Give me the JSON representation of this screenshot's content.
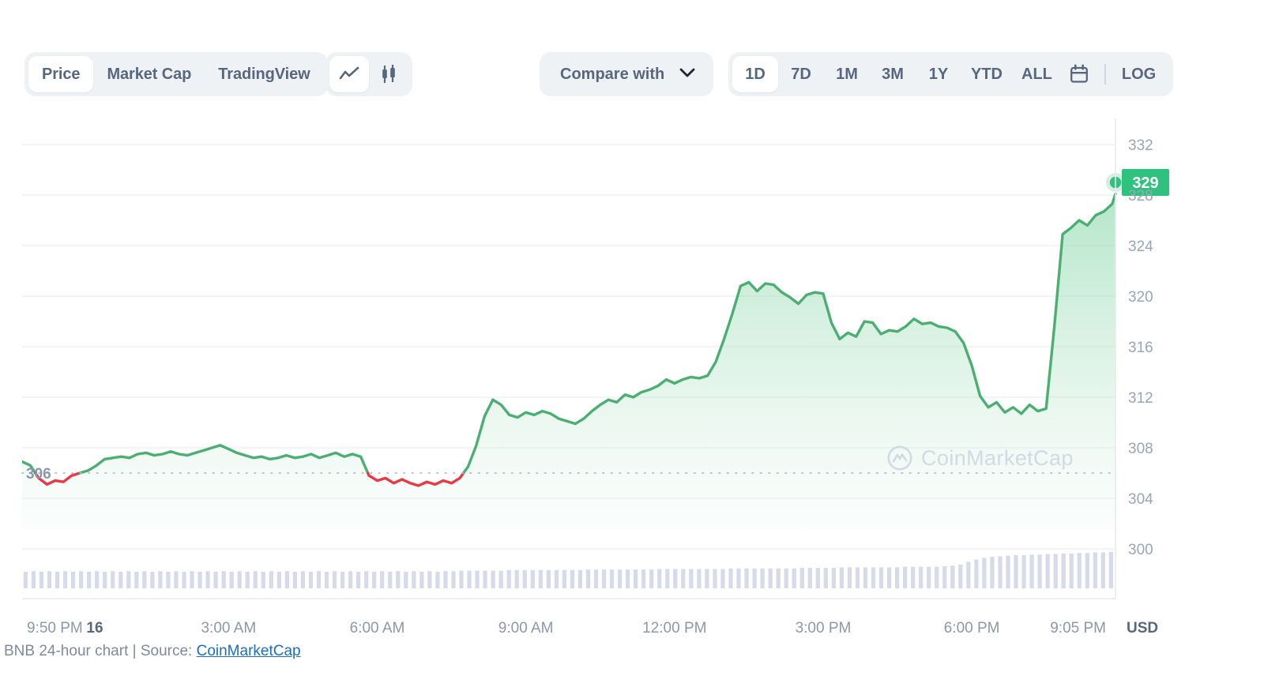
{
  "toolbar": {
    "view_tabs": [
      {
        "label": "Price",
        "active": true
      },
      {
        "label": "Market Cap",
        "active": false
      },
      {
        "label": "TradingView",
        "active": false
      }
    ],
    "chart_type_icons": [
      {
        "name": "line-chart-icon",
        "active": true
      },
      {
        "name": "candlestick-chart-icon",
        "active": false
      }
    ],
    "compare_label": "Compare with",
    "compare_chevron": "chevron-down-icon",
    "ranges": [
      {
        "label": "1D",
        "active": true
      },
      {
        "label": "7D",
        "active": false
      },
      {
        "label": "1M",
        "active": false
      },
      {
        "label": "3M",
        "active": false
      },
      {
        "label": "1Y",
        "active": false
      },
      {
        "label": "YTD",
        "active": false
      },
      {
        "label": "ALL",
        "active": false
      }
    ],
    "calendar_icon": "calendar-icon",
    "log_label": "LOG"
  },
  "watermark": "CoinMarketCap",
  "currency_label": "USD",
  "price_badge": "329",
  "baseline_label": "306",
  "footer": {
    "prefix": "BNB 24-hour chart | Source: ",
    "link": "CoinMarketCap"
  },
  "chart_data": {
    "type": "area",
    "title": "BNB 24-hour chart",
    "xlabel": "",
    "ylabel": "USD",
    "ylim": [
      298,
      333.5
    ],
    "yticks": [
      332,
      328,
      324,
      320,
      316,
      312,
      308,
      304,
      300
    ],
    "grid": true,
    "legend": null,
    "baseline_value": 306,
    "current_value": 329,
    "line_color_up": "#4caf72",
    "line_color_down": "#ea3943",
    "area_color": "#9fdcb9",
    "volume_color": "#d6daea",
    "xticks": [
      "9:50 PM",
      "16",
      "3:00 AM",
      "6:00 AM",
      "9:00 AM",
      "12:00 PM",
      "3:00 PM",
      "6:00 PM",
      "9:05 PM"
    ],
    "xtick_positions": [
      0,
      4.4,
      12.5,
      21.5,
      30.5,
      39.5,
      48.5,
      57.5,
      66.2
    ],
    "x": [
      0,
      0.5,
      1,
      1.5,
      2,
      2.5,
      3,
      3.5,
      4,
      4.5,
      5,
      5.5,
      6,
      6.5,
      7,
      7.5,
      8,
      8.5,
      9,
      9.5,
      10,
      10.5,
      11,
      11.5,
      12,
      12.5,
      13,
      13.5,
      14,
      14.5,
      15,
      15.5,
      16,
      16.5,
      17,
      17.5,
      18,
      18.5,
      19,
      19.5,
      20,
      20.5,
      21,
      21.5,
      22,
      22.5,
      23,
      23.5,
      24,
      24.5,
      25,
      25.5,
      26,
      26.5,
      27,
      27.5,
      28,
      28.5,
      29,
      29.5,
      30,
      30.5,
      31,
      31.5,
      32,
      32.5,
      33,
      33.5,
      34,
      34.5,
      35,
      35.5,
      36,
      36.5,
      37,
      37.5,
      38,
      38.5,
      39,
      39.5,
      40,
      40.5,
      41,
      41.5,
      42,
      42.5,
      43,
      43.5,
      44,
      44.5,
      45,
      45.5,
      46,
      46.5,
      47,
      47.5,
      48,
      48.5,
      49,
      49.5,
      50,
      50.5,
      51,
      51.5,
      52,
      52.5,
      53,
      53.5,
      54,
      54.5,
      55,
      55.5,
      56,
      56.5,
      57,
      57.5,
      58,
      58.5,
      59,
      59.5,
      60,
      60.5,
      61,
      61.5,
      62,
      62.5,
      63,
      63.5,
      64,
      64.5,
      65,
      65.5,
      66,
      66.2
    ],
    "y": [
      306.9,
      306.6,
      305.6,
      305.1,
      305.4,
      305.3,
      305.8,
      306.0,
      306.2,
      306.6,
      307.1,
      307.2,
      307.3,
      307.2,
      307.5,
      307.6,
      307.4,
      307.5,
      307.7,
      307.5,
      307.4,
      307.6,
      307.8,
      308.0,
      308.2,
      307.9,
      307.6,
      307.4,
      307.2,
      307.3,
      307.1,
      307.2,
      307.4,
      307.2,
      307.3,
      307.5,
      307.2,
      307.4,
      307.6,
      307.3,
      307.5,
      307.3,
      305.8,
      305.4,
      305.6,
      305.2,
      305.5,
      305.2,
      305.0,
      305.3,
      305.1,
      305.4,
      305.2,
      305.6,
      306.5,
      308.2,
      310.5,
      311.8,
      311.4,
      310.6,
      310.4,
      310.8,
      310.6,
      310.9,
      310.7,
      310.3,
      310.1,
      309.9,
      310.3,
      310.9,
      311.4,
      311.8,
      311.6,
      312.2,
      312.0,
      312.4,
      312.6,
      312.9,
      313.4,
      313.1,
      313.4,
      313.6,
      313.5,
      313.7,
      314.8,
      316.6,
      318.6,
      320.8,
      321.1,
      320.4,
      321.0,
      320.9,
      320.3,
      319.9,
      319.4,
      320.1,
      320.3,
      320.2,
      317.9,
      316.6,
      317.1,
      316.8,
      318.0,
      317.9,
      317.0,
      317.3,
      317.2,
      317.6,
      318.2,
      317.8,
      317.9,
      317.6,
      317.5,
      317.2,
      316.3,
      314.5,
      312.1,
      311.2,
      311.6,
      310.8,
      311.2,
      310.7,
      311.4,
      310.9,
      311.1,
      317.6,
      324.9,
      325.4,
      326.0,
      325.6,
      326.4,
      326.7,
      327.3,
      328.1,
      327.6,
      328.3,
      328.8,
      329.0
    ],
    "volume": [
      0.3,
      0.31,
      0.3,
      0.31,
      0.3,
      0.31,
      0.3,
      0.31,
      0.3,
      0.31,
      0.3,
      0.31,
      0.3,
      0.31,
      0.3,
      0.31,
      0.3,
      0.31,
      0.3,
      0.31,
      0.3,
      0.31,
      0.3,
      0.31,
      0.3,
      0.31,
      0.3,
      0.31,
      0.3,
      0.31,
      0.3,
      0.31,
      0.3,
      0.31,
      0.3,
      0.31,
      0.3,
      0.31,
      0.3,
      0.31,
      0.3,
      0.31,
      0.3,
      0.31,
      0.3,
      0.31,
      0.3,
      0.31,
      0.3,
      0.31,
      0.3,
      0.31,
      0.3,
      0.31,
      0.31,
      0.32,
      0.32,
      0.32,
      0.32,
      0.32,
      0.32,
      0.33,
      0.33,
      0.33,
      0.33,
      0.33,
      0.33,
      0.33,
      0.33,
      0.33,
      0.33,
      0.34,
      0.34,
      0.34,
      0.34,
      0.34,
      0.34,
      0.34,
      0.34,
      0.34,
      0.35,
      0.35,
      0.35,
      0.35,
      0.35,
      0.35,
      0.35,
      0.35,
      0.35,
      0.36,
      0.36,
      0.36,
      0.36,
      0.36,
      0.36,
      0.36,
      0.36,
      0.36,
      0.37,
      0.37,
      0.37,
      0.37,
      0.37,
      0.38,
      0.38,
      0.38,
      0.38,
      0.38,
      0.38,
      0.38,
      0.38,
      0.39,
      0.39,
      0.39,
      0.39,
      0.39,
      0.4,
      0.41,
      0.43,
      0.48,
      0.52,
      0.55,
      0.57,
      0.58,
      0.59,
      0.6,
      0.6,
      0.61,
      0.61,
      0.62,
      0.62,
      0.63,
      0.63,
      0.64,
      0.64,
      0.65,
      0.65,
      0.66
    ]
  }
}
